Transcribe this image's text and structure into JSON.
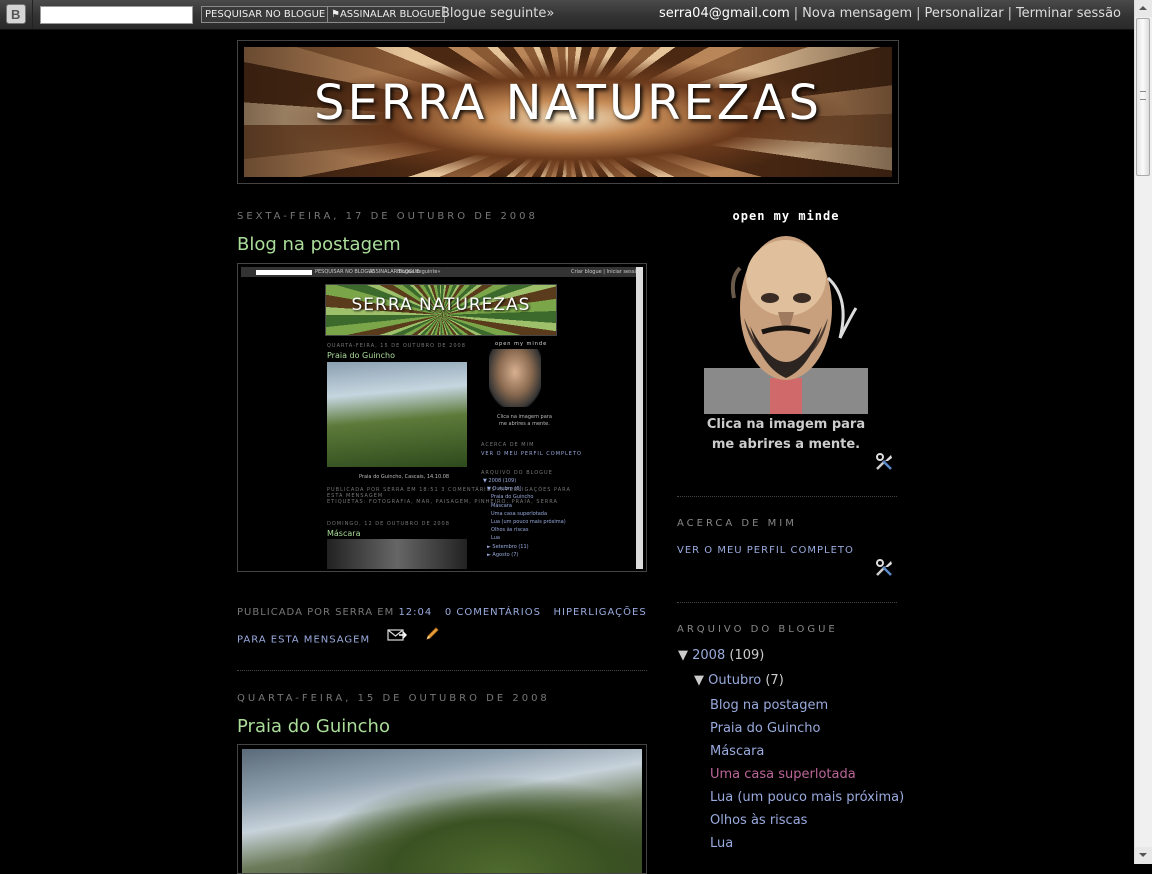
{
  "navbar": {
    "search_button": "PESQUISAR NO BLOGUE",
    "flag_button": "ASSINALAR BLOGUE",
    "next_blog": "Blogue seguinte»",
    "user_email": "serra04@gmail.com",
    "new_post": "Nova mensagem",
    "customize": "Personalizar",
    "sign_out": "Terminar sessão"
  },
  "header": {
    "title": "SERRA NATUREZAS"
  },
  "posts": [
    {
      "date": "SEXTA-FEIRA, 17 DE OUTUBRO DE 2008",
      "title": "Blog na postagem",
      "screenshot": {
        "search_button": "PESQUISAR NO BLOGUE",
        "flag_button": "ASSINALAR BLOGUE",
        "next_blog": "Blogue seguinte»",
        "right_links": "Criar blogue | Iniciar sessão",
        "title": "SERRA NATUREZAS",
        "date1": "QUARTA-FEIRA, 15 DE OUTUBRO DE 2008",
        "post_title1": "Praia do Guincho",
        "caption1": "Praia do Guincho, Cascais, 14.10.08",
        "footer1": "PUBLICADA POR SERRA EM 18:51   3 COMENTÁRIOS   HIPERLIGAÇÕES PARA",
        "footer2": "ESTA MENSAGEM",
        "labels": "ETIQUETAS: FOTOGRAFIA, MAR, PAISAGEM, PINHEIRO, PRAIA, SERRA",
        "date2": "DOMINGO, 12 DE OUTUBRO DE 2008",
        "post_title2": "Máscara",
        "side_title": "open my minde",
        "side_caption1": "Clica na imagem para",
        "side_caption2": "me abrires a mente.",
        "about_head": "ACERCA DE MIM",
        "profile": "VER O MEU PERFIL COMPLETO",
        "archive_head": "ARQUIVO DO BLOGUE",
        "archive": [
          "▼ 2008 (109)",
          "▼ Outubro (6)",
          "Praia do Guincho",
          "Máscara",
          "Uma casa superlotada",
          "Lua (um pouco mais próxima)",
          "Olhos às riscas",
          "Lua",
          "► Setembro (11)",
          "► Agosto (7)"
        ]
      },
      "footer": {
        "published_by": "PUBLICADA POR SERRA EM",
        "time": "12:04",
        "comments": "0 COMENTÁRIOS",
        "links": "HIPERLIGAÇÕES PARA ESTA MENSAGEM"
      }
    },
    {
      "date": "QUARTA-FEIRA, 15 DE OUTUBRO DE 2008",
      "title": "Praia do Guincho"
    }
  ],
  "sidebar": {
    "profile_image_title": "open my minde",
    "caption_line1": "Clica na imagem para",
    "caption_line2": "me abrires a mente.",
    "about_heading": "ACERCA DE MIM",
    "profile_link": "VER O MEU PERFIL COMPLETO",
    "archive_heading": "ARQUIVO DO BLOGUE",
    "archive": {
      "year": "2008",
      "year_count": "(109)",
      "month": "Outubro",
      "month_count": "(7)",
      "posts": [
        "Blog na postagem",
        "Praia do Guincho",
        "Máscara",
        "Uma casa superlotada",
        "Lua (um pouco mais próxima)",
        "Olhos às riscas",
        "Lua"
      ]
    }
  },
  "colors": {
    "background": "#000000",
    "post_title": "#aadd99",
    "link": "#99aadd",
    "visited_link": "#bb6699",
    "muted_text": "#777777"
  }
}
